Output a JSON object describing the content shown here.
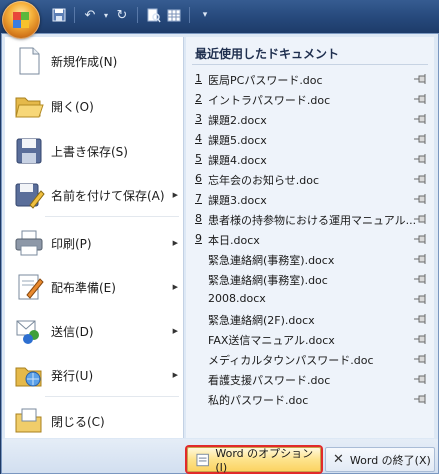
{
  "quick_access": {
    "save_icon": "save-icon",
    "undo_icon": "undo-icon",
    "redo_icon": "redo-icon",
    "preview_icon": "print-preview-icon",
    "table_icon": "table-icon",
    "customize_icon": "chevron-down-icon"
  },
  "commands": [
    {
      "id": "new",
      "label": "新規作成(N)",
      "icon": "new-document-icon",
      "arrow": false
    },
    {
      "id": "open",
      "label": "開く(O)",
      "icon": "open-folder-icon",
      "arrow": false
    },
    {
      "id": "save",
      "label": "上書き保存(S)",
      "icon": "save-disk-icon",
      "arrow": false
    },
    {
      "id": "save-as",
      "label": "名前を付けて保存(A)",
      "icon": "save-as-icon",
      "arrow": true
    },
    {
      "id": "print",
      "label": "印刷(P)",
      "icon": "printer-icon",
      "arrow": true
    },
    {
      "id": "prepare",
      "label": "配布準備(E)",
      "icon": "prepare-icon",
      "arrow": true
    },
    {
      "id": "send",
      "label": "送信(D)",
      "icon": "send-icon",
      "arrow": true
    },
    {
      "id": "publish",
      "label": "発行(U)",
      "icon": "publish-icon",
      "arrow": true
    },
    {
      "id": "close",
      "label": "閉じる(C)",
      "icon": "close-folder-icon",
      "arrow": false
    }
  ],
  "recent": {
    "title": "最近使用したドキュメント",
    "items": [
      {
        "num": "1",
        "name": "医局PCパスワード.doc"
      },
      {
        "num": "2",
        "name": "イントラパスワード.doc"
      },
      {
        "num": "3",
        "name": "課題2.docx"
      },
      {
        "num": "4",
        "name": "課題5.docx"
      },
      {
        "num": "5",
        "name": "課題4.docx"
      },
      {
        "num": "6",
        "name": "忘年会のお知らせ.doc"
      },
      {
        "num": "7",
        "name": "課題3.docx"
      },
      {
        "num": "8",
        "name": "患者様の持参物における運用マニュアル..."
      },
      {
        "num": "9",
        "name": "本日.docx"
      },
      {
        "num": "",
        "name": "緊急連絡網(事務室).docx"
      },
      {
        "num": "",
        "name": "緊急連絡網(事務室).doc"
      },
      {
        "num": "",
        "name": "2008.docx"
      },
      {
        "num": "",
        "name": "緊急連絡網(2F).docx"
      },
      {
        "num": "",
        "name": "FAX送信マニュアル.docx"
      },
      {
        "num": "",
        "name": "メディカルタウンパスワード.doc"
      },
      {
        "num": "",
        "name": "看護支援パスワード.doc"
      },
      {
        "num": "",
        "name": "私的パスワード.doc"
      }
    ]
  },
  "footer": {
    "options_label": "Word のオプション(I)",
    "exit_label": "Word の終了(X)"
  },
  "colors": {
    "highlight_outline": "#e12a2a",
    "options_button": "#fde38c"
  }
}
